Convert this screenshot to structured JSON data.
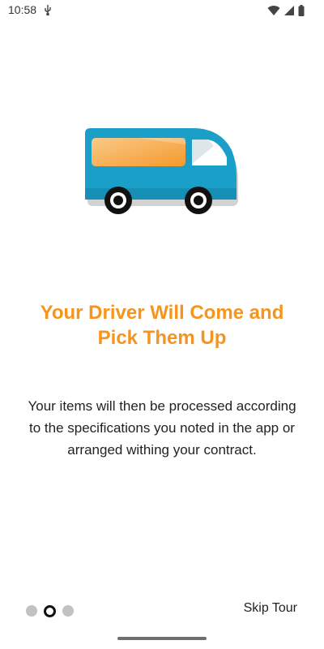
{
  "status_bar": {
    "time": "10:58",
    "icons": [
      "usb-icon",
      "wifi-icon",
      "signal-icon",
      "battery-icon"
    ]
  },
  "onboarding": {
    "illustration": "van-illustration",
    "title_line1": "Your Driver Will Come and",
    "title_line2": "Pick Them Up",
    "body_line1": "Your items will then be processed according",
    "body_line2": "to the specifications you noted in the app or",
    "body_line3": "arranged withing your contract.",
    "page_count": 3,
    "active_page": 2
  },
  "footer": {
    "skip_label": "Skip Tour"
  },
  "colors": {
    "accent": "#f7941d",
    "van_body": "#1a9fc9",
    "dot_inactive": "#c2c2c2"
  }
}
